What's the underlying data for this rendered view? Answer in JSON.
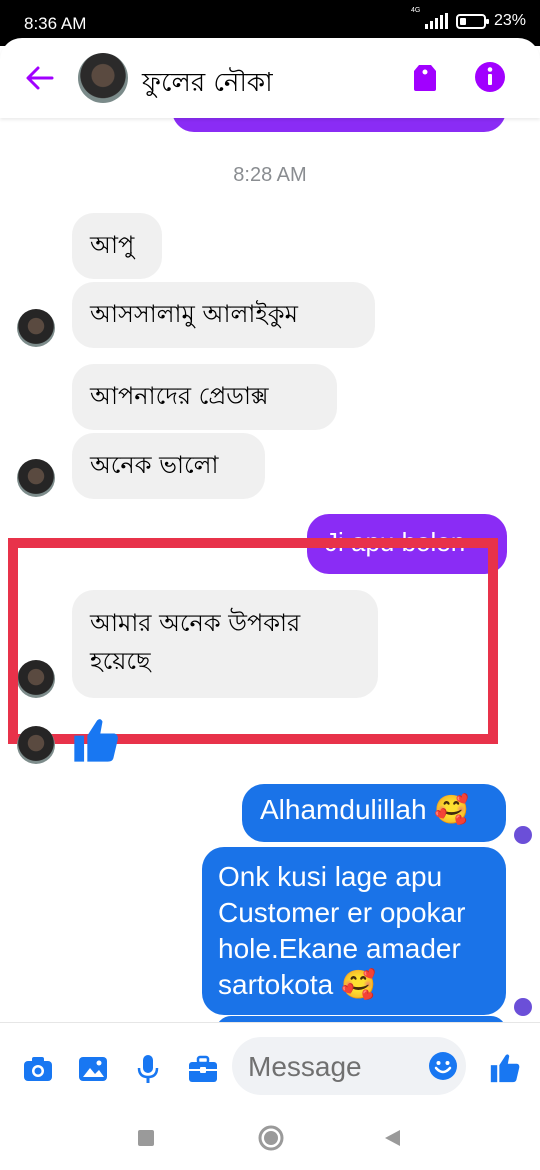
{
  "status_bar": {
    "time": "8:36 AM",
    "network": "4G",
    "battery": "23%",
    "battery_level": 0.23
  },
  "header": {
    "contact_name": "ফুলের নৌকা"
  },
  "chat": {
    "timestamp": "8:28 AM",
    "partial_top_text": "…",
    "incoming_1": "আপু",
    "incoming_2": "আসসালামু আলাইকুম",
    "incoming_3": "আপনাদের প্রেডাক্স",
    "incoming_4": "অনেক ভালো",
    "outgoing_1": "Ji apu bolen",
    "incoming_5": "আমার অনেক উপকার হয়েছে",
    "outgoing_2": "Alhamdulillah 🥰",
    "outgoing_3": "Onk kusi lage apu Customer er opokar hole.Ekane amader sartokota 🥰"
  },
  "composer": {
    "placeholder": "Message"
  },
  "colors": {
    "accent_purple": "#a100ff",
    "bubble_purple": "#8a2cf5",
    "bubble_blue": "#1a73e8",
    "incoming_bg": "#f0f0f0",
    "highlight": "#e8324a",
    "composer_blue": "#1877f2"
  },
  "icons": [
    "back-arrow-icon",
    "tag-icon",
    "info-icon",
    "camera-icon",
    "image-icon",
    "microphone-icon",
    "briefcase-icon",
    "emoji-icon",
    "thumbs-up-icon",
    "nav-square-icon",
    "nav-circle-icon",
    "nav-back-icon"
  ]
}
